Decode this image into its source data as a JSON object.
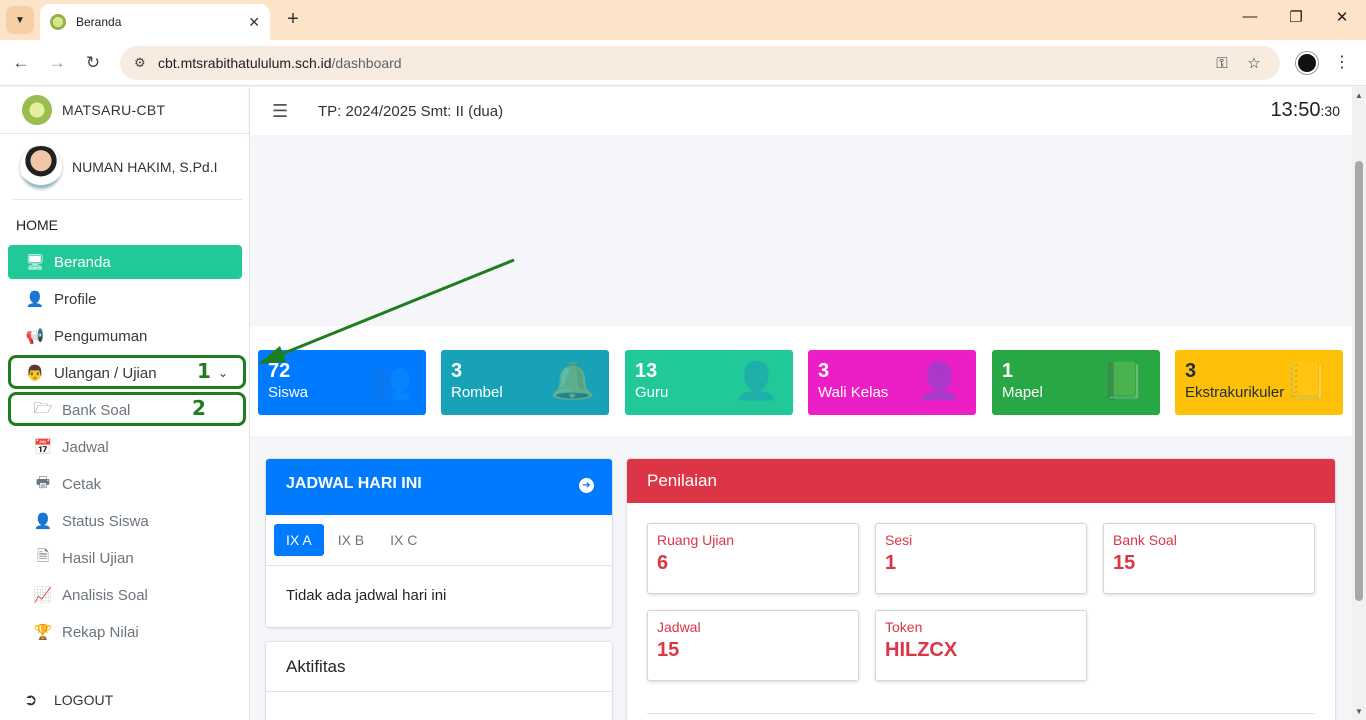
{
  "browser": {
    "tab_title": "Beranda",
    "url_host": "cbt.mtsrabithatululum.sch.id",
    "url_path": "/dashboard"
  },
  "sidebar": {
    "brand": "MATSARU-CBT",
    "user_name": "NUMAN HAKIM, S.Pd.I",
    "header": "HOME",
    "items": [
      {
        "label": "Beranda",
        "icon": "desktop-icon"
      },
      {
        "label": "Profile",
        "icon": "user-icon"
      },
      {
        "label": "Pengumuman",
        "icon": "megaphone-icon"
      },
      {
        "label": "Ulangan / Ujian",
        "icon": "teacher-icon"
      },
      {
        "label": "Bank Soal",
        "icon": "folder-open-icon"
      },
      {
        "label": "Jadwal",
        "icon": "calendar-icon"
      },
      {
        "label": "Cetak",
        "icon": "printer-icon"
      },
      {
        "label": "Status Siswa",
        "icon": "user-clock-icon"
      },
      {
        "label": "Hasil Ujian",
        "icon": "file-icon"
      },
      {
        "label": "Analisis Soal",
        "icon": "chart-line-icon"
      },
      {
        "label": "Rekap Nilai",
        "icon": "trophy-icon"
      }
    ],
    "logout": "LOGOUT",
    "annotations": {
      "step1": "1",
      "step2": "2"
    }
  },
  "header": {
    "tp": "TP: 2024/2025 Smt: II (dua)",
    "time_hm": "13:50",
    "time_s": ":30"
  },
  "stats": [
    {
      "num": "72",
      "label": "Siswa",
      "color": "#007bff",
      "icon": "users-icon"
    },
    {
      "num": "3",
      "label": "Rombel",
      "color": "#17a2b8",
      "icon": "bell-icon"
    },
    {
      "num": "13",
      "label": "Guru",
      "color": "#20c997",
      "icon": "user-icon"
    },
    {
      "num": "3",
      "label": "Wali Kelas",
      "color": "#e83e8c",
      "icon": "user-icon"
    },
    {
      "num": "1",
      "label": "Mapel",
      "color": "#28a745",
      "icon": "book-icon"
    },
    {
      "num": "3",
      "label": "Ekstrakurikuler",
      "color": "#ffc107",
      "icon": "book-icon"
    }
  ],
  "jadwal": {
    "title": "JADWAL HARI INI",
    "tabs": [
      "IX A",
      "IX B",
      "IX C"
    ],
    "empty": "Tidak ada jadwal hari ini"
  },
  "aktifitas": {
    "title": "Aktifitas"
  },
  "penilaian": {
    "title": "Penilaian",
    "items": [
      {
        "label": "Ruang Ujian",
        "value": "6"
      },
      {
        "label": "Sesi",
        "value": "1"
      },
      {
        "label": "Bank Soal",
        "value": "15"
      },
      {
        "label": "Jadwal",
        "value": "15"
      },
      {
        "label": "Token",
        "value": "HILZCX"
      }
    ]
  }
}
